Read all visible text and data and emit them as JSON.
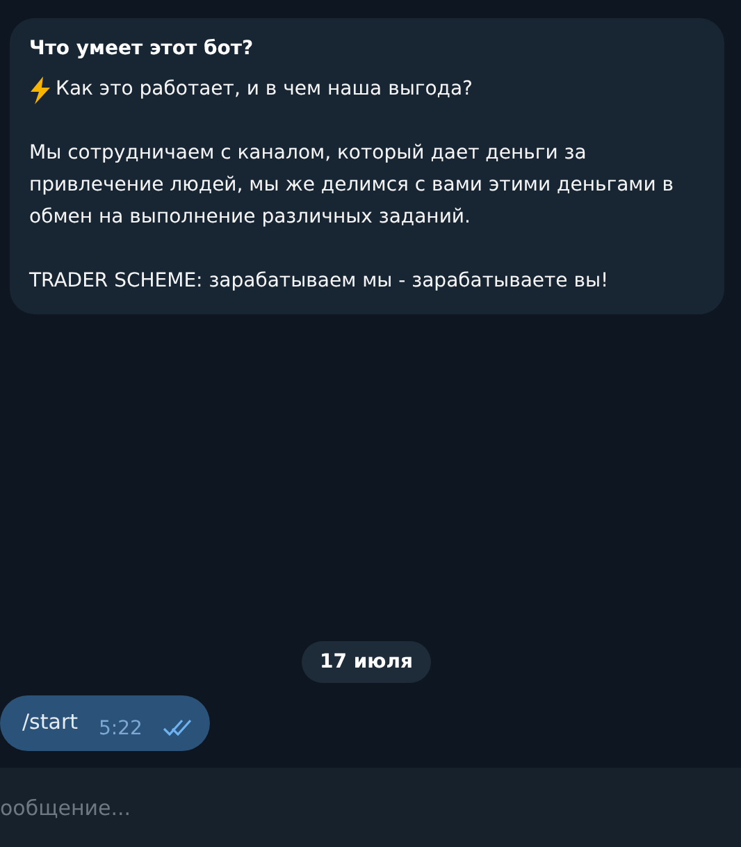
{
  "bot_info": {
    "title": "Что умеет этот бот?",
    "paragraphs": [
      {
        "text": "Как это работает, и в чем наша выгода?",
        "kind": "bolt"
      },
      {
        "text": "Мы сотрудничаем с каналом, который дает деньги за привлечение людей, мы же делимся с вами этими деньгами в обмен на выполнение различных заданий.",
        "kind": "plain"
      },
      {
        "text": "TRADER SCHEME: зарабатываем мы - зарабатываете вы!",
        "kind": "plain"
      }
    ]
  },
  "date_badge": "17 июля",
  "messages": [
    {
      "text": "/start",
      "time": "5:22",
      "read": true
    }
  ],
  "composer": {
    "placeholder": "ообщение..."
  }
}
